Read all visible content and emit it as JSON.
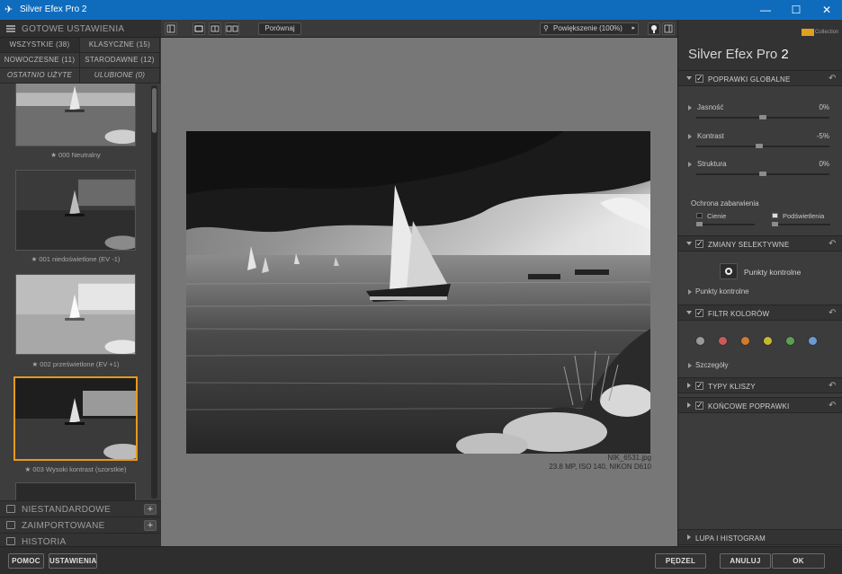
{
  "window": {
    "title": "Silver Efex Pro 2",
    "controls": [
      "—",
      "☐",
      "✕"
    ]
  },
  "left_panel": {
    "header": "GOTOWE USTAWIENIA",
    "tabs": [
      {
        "label": "WSZYSTKIE (38)"
      },
      {
        "label": "KLASYCZNE (15)"
      },
      {
        "label": "NOWOCZESNE (11)"
      },
      {
        "label": "STARODAWNE (12)"
      },
      {
        "label": "OSTATNIO UŻYTE"
      },
      {
        "label": "ULUBIONE (0)"
      }
    ],
    "presets": [
      {
        "label": "★ 000 Neutralny"
      },
      {
        "label": "★ 001 niedoświetlone (EV -1)"
      },
      {
        "label": "★ 002 prześwietlone (EV +1)"
      },
      {
        "label": "★ 003 Wysoki kontrast (szorstkie)",
        "selected": true
      }
    ],
    "sections": [
      {
        "label": "NIESTANDARDOWE",
        "plus": "+"
      },
      {
        "label": "ZAIMPORTOWANE",
        "plus": "+"
      },
      {
        "label": "HISTORIA"
      }
    ]
  },
  "toolbar": {
    "compare_label": "Porównaj",
    "zoom_label": "Powiększenie (100%)"
  },
  "image": {
    "filename": "NIK_6531.jpg",
    "info": "23.8 MP, ISO 140, NIKON D610"
  },
  "right_panel": {
    "brand": "Nik",
    "brand_sub": "Collection",
    "app_title_main": "Silver Efex Pro",
    "app_title_ver": "2",
    "global": {
      "title": "POPRAWKI GLOBALNE",
      "sliders": [
        {
          "label": "Jasność",
          "value": "0%",
          "level": 0.5
        },
        {
          "label": "Kontrast",
          "value": "-5%",
          "level": 0.47
        },
        {
          "label": "Struktura",
          "value": "0%",
          "level": 0.5
        }
      ],
      "protection_title": "Ochrona zabarwienia",
      "shadows": "Cienie",
      "highlights": "Podświetlenia"
    },
    "selective": {
      "title": "ZMIANY SELEKTYWNE",
      "button": "Punkty kontrolne",
      "sub": "Punkty kontrolne"
    },
    "color_filter": {
      "title": "FILTR KOLORÓW",
      "colors": [
        "#9a9a9a",
        "#c85a5a",
        "#d07a30",
        "#c8b830",
        "#5aa050",
        "#6a9ad0"
      ],
      "sub": "Szczegóły"
    },
    "film": {
      "title": "TYPY KLISZY"
    },
    "finishing": {
      "title": "KOŃCOWE POPRAWKI"
    },
    "loupe": {
      "title": "LUPA I HISTOGRAM"
    }
  },
  "bottom": {
    "help": "POMOC",
    "settings": "USTAWIENIA",
    "brush": "PĘDZEL",
    "cancel": "ANULUJ",
    "ok": "OK"
  }
}
